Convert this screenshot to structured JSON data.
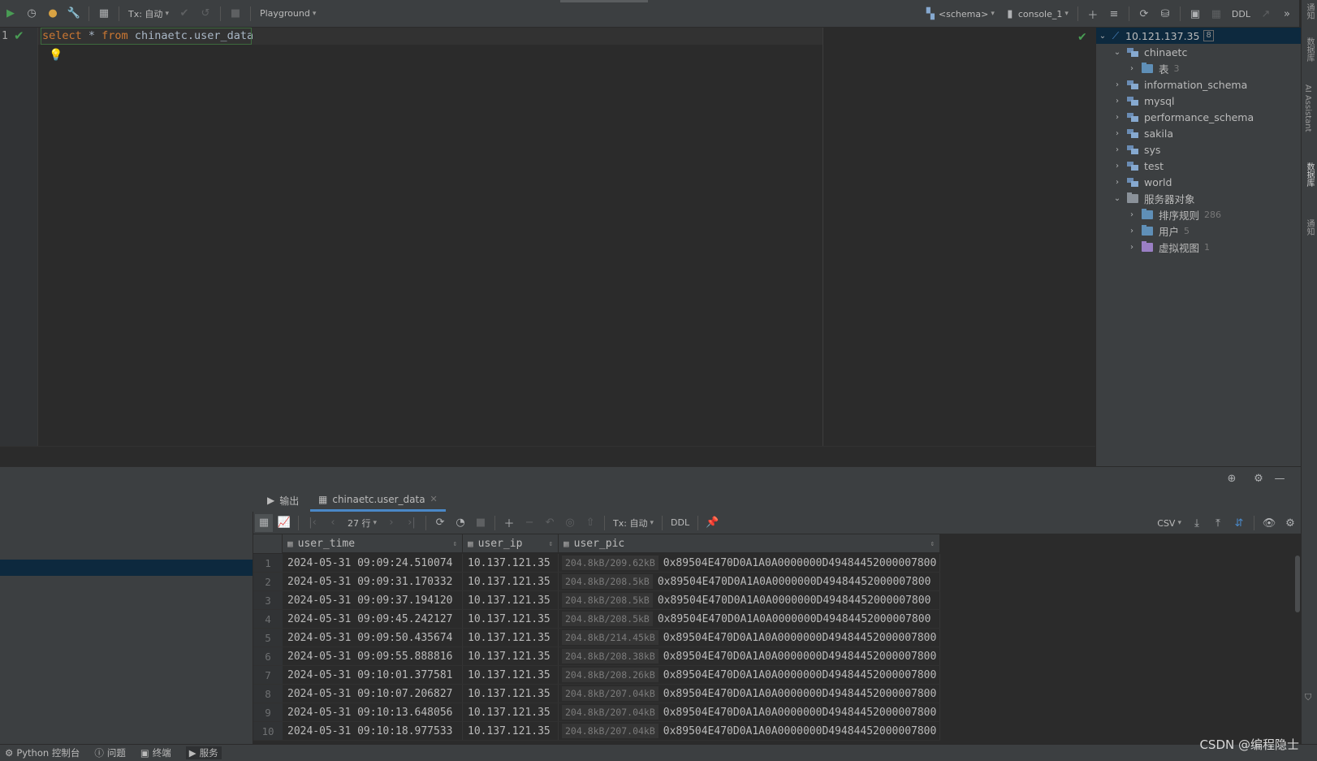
{
  "toolbar": {
    "tx_mode": "Tx: 自动",
    "playground": "Playground",
    "schema": "<schema>",
    "console": "console_1",
    "ddl": "DDL"
  },
  "editor": {
    "line_number": "1",
    "sql_kw_select": "select",
    "sql_star": " * ",
    "sql_kw_from": "from",
    "sql_table": " chinaetc.user_data"
  },
  "tree": {
    "root": {
      "label": "10.121.137.35",
      "badge": "8"
    },
    "items": [
      {
        "label": "chinaetc"
      },
      {
        "label": "表",
        "count": "3"
      },
      {
        "label": "information_schema"
      },
      {
        "label": "mysql"
      },
      {
        "label": "performance_schema"
      },
      {
        "label": "sakila"
      },
      {
        "label": "sys"
      },
      {
        "label": "test"
      },
      {
        "label": "world"
      },
      {
        "label": "服务器对象"
      },
      {
        "label": "排序规则",
        "count": "286"
      },
      {
        "label": "用户",
        "count": "5"
      },
      {
        "label": "虚拟视图",
        "count": "1"
      }
    ]
  },
  "side_strip": {
    "label1": "通知",
    "label2": "AI Assistant",
    "label3": "数据库",
    "label4": "通知",
    "label5": "数据库"
  },
  "bottom": {
    "tab_output": "输出",
    "tab_result": "chinaetc.user_data",
    "rows_label": "27 行",
    "tx_mode": "Tx: 自动",
    "ddl": "DDL",
    "csv": "CSV"
  },
  "grid": {
    "columns": [
      "user_time",
      "user_ip",
      "user_pic"
    ],
    "rows": [
      {
        "n": "1",
        "time": "2024-05-31 09:09:24.510074",
        "ip": "10.137.121.35",
        "size": "204.8kB/209.62kB",
        "pic": "0x89504E470D0A1A0A0000000D49484452000007800"
      },
      {
        "n": "2",
        "time": "2024-05-31 09:09:31.170332",
        "ip": "10.137.121.35",
        "size": "204.8kB/208.5kB",
        "pic": "0x89504E470D0A1A0A0000000D49484452000007800"
      },
      {
        "n": "3",
        "time": "2024-05-31 09:09:37.194120",
        "ip": "10.137.121.35",
        "size": "204.8kB/208.5kB",
        "pic": "0x89504E470D0A1A0A0000000D49484452000007800"
      },
      {
        "n": "4",
        "time": "2024-05-31 09:09:45.242127",
        "ip": "10.137.121.35",
        "size": "204.8kB/208.5kB",
        "pic": "0x89504E470D0A1A0A0000000D49484452000007800"
      },
      {
        "n": "5",
        "time": "2024-05-31 09:09:50.435674",
        "ip": "10.137.121.35",
        "size": "204.8kB/214.45kB",
        "pic": "0x89504E470D0A1A0A0000000D49484452000007800"
      },
      {
        "n": "6",
        "time": "2024-05-31 09:09:55.888816",
        "ip": "10.137.121.35",
        "size": "204.8kB/208.38kB",
        "pic": "0x89504E470D0A1A0A0000000D49484452000007800"
      },
      {
        "n": "7",
        "time": "2024-05-31 09:10:01.377581",
        "ip": "10.137.121.35",
        "size": "204.8kB/208.26kB",
        "pic": "0x89504E470D0A1A0A0000000D49484452000007800"
      },
      {
        "n": "8",
        "time": "2024-05-31 09:10:07.206827",
        "ip": "10.137.121.35",
        "size": "204.8kB/207.04kB",
        "pic": "0x89504E470D0A1A0A0000000D49484452000007800"
      },
      {
        "n": "9",
        "time": "2024-05-31 09:10:13.648056",
        "ip": "10.137.121.35",
        "size": "204.8kB/207.04kB",
        "pic": "0x89504E470D0A1A0A0000000D49484452000007800"
      },
      {
        "n": "10",
        "time": "2024-05-31 09:10:18.977533",
        "ip": "10.137.121.35",
        "size": "204.8kB/207.04kB",
        "pic": "0x89504E470D0A1A0A0000000D49484452000007800"
      }
    ]
  },
  "statusbar": {
    "python_console": "Python 控制台",
    "problems": "问题",
    "terminal": "终端",
    "services": "服务"
  },
  "watermark": "CSDN @编程隐士",
  "colors": {
    "accent": "#4a88c7",
    "keyword": "#cc7832",
    "success": "#499c54",
    "selection": "#0d293e"
  }
}
